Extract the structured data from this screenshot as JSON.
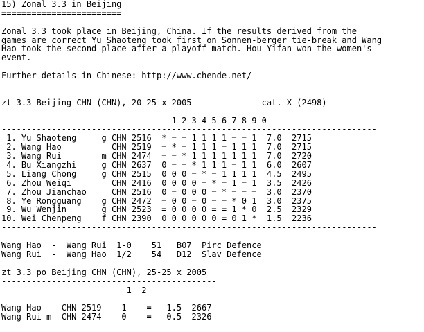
{
  "document": {
    "lines": [
      "15) Zonal 3.3 in Beijing",
      "========================",
      "",
      "Zonal 3.3 took place in Beijing, China. If the results derived from the",
      "games are correct Yu Shaoteng took first on Sonnen-berger tie-break and Wang",
      "Hao took the second place after a playoff match. Hou Yifan won the women's",
      "event.",
      "",
      "Further details in Chinese: http://www.chende.net/",
      "",
      "---------------------------------------------------------------------------",
      "zt 3.3 Beijing CHN (CHN), 20-25 x 2005              cat. X (2498)",
      "---------------------------------------------------------------------------",
      "                                  1 2 3 4 5 6 7 8 9 0",
      "---------------------------------------------------------------------------",
      " 1. Yu Shaoteng     g CHN 2516  * = = 1 1 1 1 = = 1  7.0  2715",
      " 2. Wang Hao          CHN 2519  = * = 1 1 1 = 1 1 1  7.0  2715",
      " 3. Wang Rui        m CHN 2474  = = * 1 1 1 1 1 1 1  7.0  2720",
      " 4. Bu Xiangzhi     g CHN 2637  0 = = * 1 1 1 = 1 1  6.0  2607",
      " 5. Liang Chong     g CHN 2515  0 0 0 = * = 1 1 1 1  4.5  2495",
      " 6. Zhou Weiqi        CHN 2416  0 0 0 0 = * = 1 = 1  3.5  2426",
      " 7. Zhou Jianchao     CHN 2516  0 = 0 0 0 = * = = =  3.0  2370",
      " 8. Ye Rongguang    g CHN 2472  = 0 0 = 0 = = * 0 1  3.0  2375",
      " 9. Wu Wenjin       g CHN 2523  = 0 0 0 0 = = 1 * 0  2.5  2329",
      "10. Wei Chenpeng    f CHN 2390  0 0 0 0 0 0 = 0 1 *  1.5  2236",
      "---------------------------------------------------------------------------",
      "",
      "Wang Hao  -  Wang Rui  1-0    51   B07  Pirc Defence",
      "Wang Rui  -  Wang Hao  1/2    54   D12  Slav Defence",
      "",
      "zt 3.3 po Beijing CHN (CHN), 25-25 x 2005",
      "-------------------------------------------",
      "                         1  2",
      "-------------------------------------------",
      "Wang Hao    CHN 2519    1    =   1.5  2667",
      "Wang Rui m  CHN 2474    0    =   0.5  2326",
      "-------------------------------------------"
    ]
  }
}
